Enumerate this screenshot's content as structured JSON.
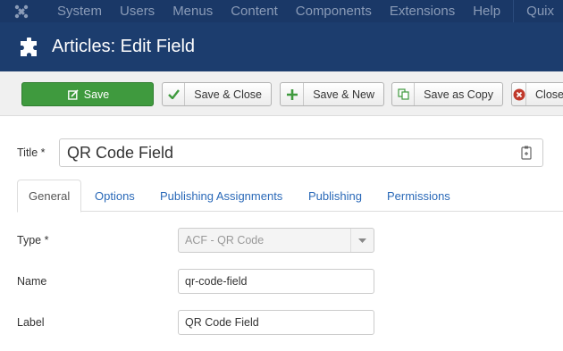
{
  "topnav": {
    "logo_icon": "joomla-logo-icon",
    "items": [
      "System",
      "Users",
      "Menus",
      "Content",
      "Components",
      "Extensions",
      "Help"
    ],
    "right_item": "Quix"
  },
  "header": {
    "icon": "puzzle-icon",
    "title": "Articles: Edit Field"
  },
  "toolbar": {
    "save": "Save",
    "save_close": "Save & Close",
    "save_new": "Save & New",
    "save_copy": "Save as Copy",
    "close": "Close"
  },
  "form": {
    "title_label": "Title *",
    "title_value": "QR Code Field",
    "tabs": [
      "General",
      "Options",
      "Publishing Assignments",
      "Publishing",
      "Permissions"
    ],
    "type_label": "Type *",
    "type_value": "ACF - QR Code",
    "name_label": "Name",
    "name_value": "qr-code-field",
    "label_label": "Label",
    "label_value": "QR Code Field"
  },
  "colors": {
    "nav_bg": "#1a3867",
    "header_bg": "#1c3d6e",
    "save_green": "#3f9a3e",
    "link_blue": "#2a69b8"
  }
}
